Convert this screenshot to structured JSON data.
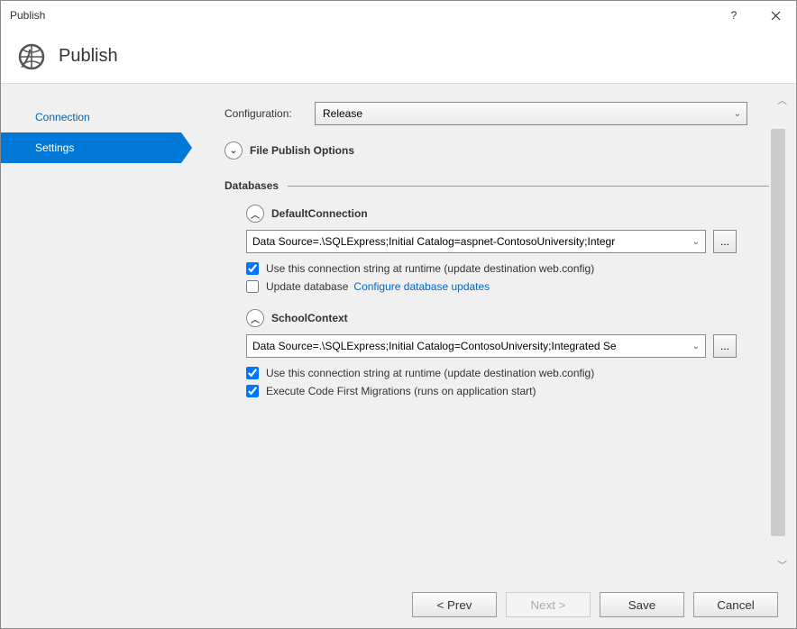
{
  "window": {
    "title": "Publish"
  },
  "header": {
    "title": "Publish"
  },
  "sidebar": {
    "items": [
      {
        "label": "Connection",
        "active": false
      },
      {
        "label": "Settings",
        "active": true
      }
    ]
  },
  "settings": {
    "config_label": "Configuration:",
    "config_value": "Release",
    "file_publish_options_label": "File Publish Options",
    "databases_label": "Databases",
    "databases": [
      {
        "name": "DefaultConnection",
        "conn": "Data Source=.\\SQLExpress;Initial Catalog=aspnet-ContosoUniversity;Integr",
        "checkbox1": {
          "checked": true,
          "label": "Use this connection string at runtime (update destination web.config)"
        },
        "checkbox2": {
          "checked": false,
          "label": "Update database"
        },
        "link": "Configure database updates"
      },
      {
        "name": "SchoolContext",
        "conn": "Data Source=.\\SQLExpress;Initial Catalog=ContosoUniversity;Integrated Se",
        "checkbox1": {
          "checked": true,
          "label": "Use this connection string at runtime (update destination web.config)"
        },
        "checkbox2": {
          "checked": true,
          "label": "Execute Code First Migrations (runs on application start)"
        }
      }
    ]
  },
  "footer": {
    "prev": "< Prev",
    "next": "Next >",
    "save": "Save",
    "cancel": "Cancel"
  },
  "browse_label": "..."
}
